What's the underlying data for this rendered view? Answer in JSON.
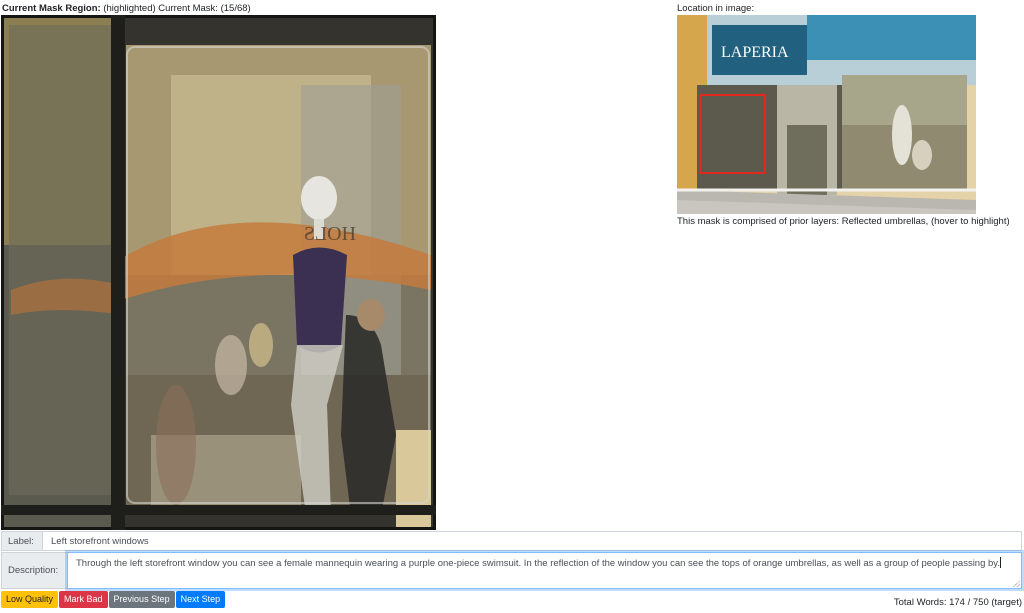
{
  "header": {
    "mask_region_label": "Current Mask Region:",
    "mask_region_status": "(highlighted)",
    "current_mask_text": "Current Mask: (15/68)"
  },
  "location": {
    "title": "Location in image:",
    "storefront_sign": "LAPERIA",
    "prior_layers_text": "This mask is comprised of prior layers: Reflected umbrellas,  (hover to highlight)"
  },
  "main_image": {
    "reflection_sign": "HOLS"
  },
  "form": {
    "label_addon": "Label:",
    "label_value": "Left storefront windows",
    "description_addon": "Description:",
    "description_value": "Through the left storefront window you can see a female mannequin wearing a purple one-piece swimsuit. In the reflection of the window you can see the tops of orange umbrellas, as well as a group of people passing by."
  },
  "buttons": {
    "low_quality": "Low Quality",
    "mark_bad": "Mark Bad",
    "previous_step": "Previous Step",
    "next_step": "Next Step"
  },
  "footer": {
    "total_words": "Total Words: 174 / 750 (target)"
  },
  "colors": {
    "highlight_box": "#e0281e",
    "focus_border": "#80bdff",
    "warning": "#ffc107",
    "danger": "#dc3545",
    "secondary": "#6c757d",
    "primary": "#007bff"
  }
}
